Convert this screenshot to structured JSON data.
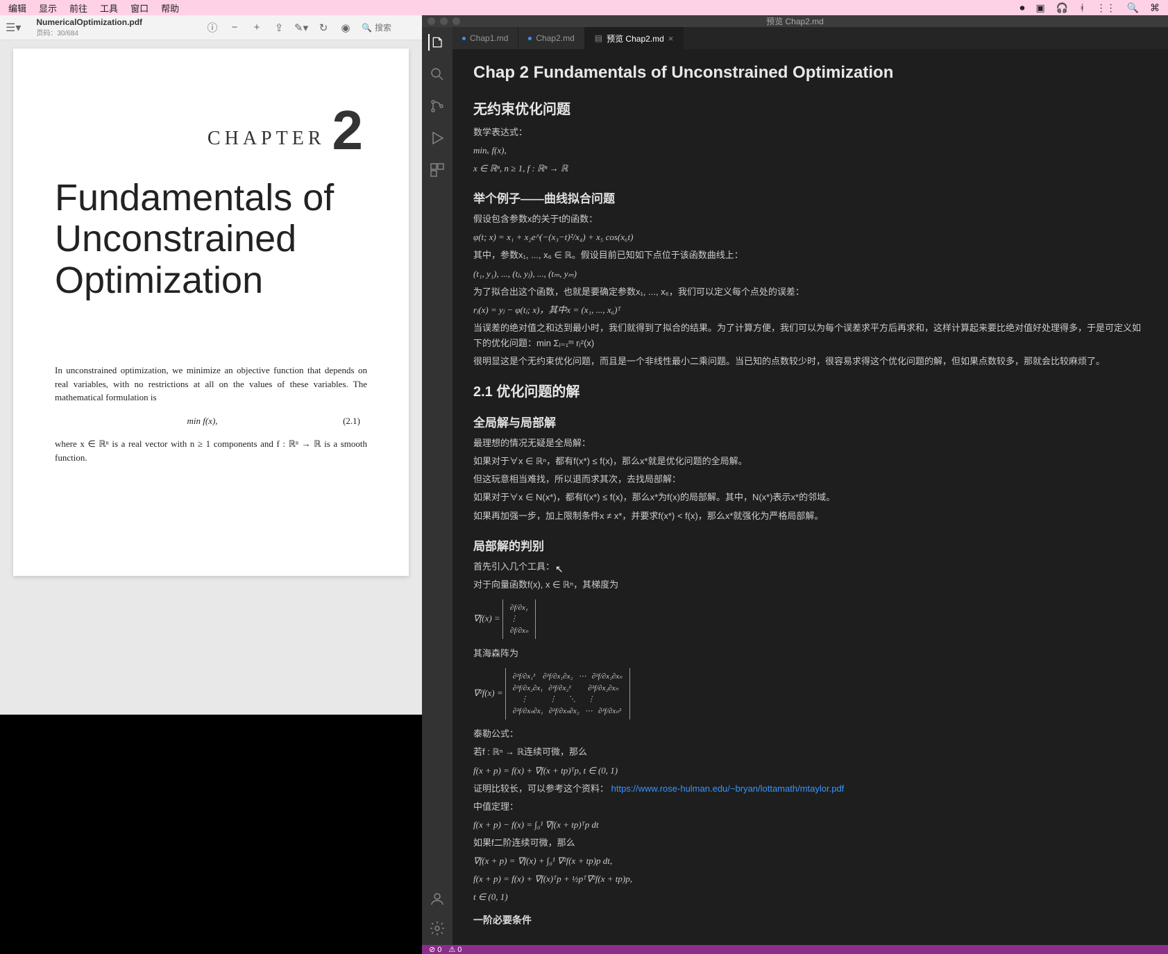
{
  "menubar": {
    "items": [
      "编辑",
      "显示",
      "前往",
      "工具",
      "窗口",
      "帮助"
    ],
    "right_icons": [
      "record",
      "screenshare",
      "headphones",
      "bluetooth",
      "wifi",
      "search",
      "control-center"
    ]
  },
  "pdf": {
    "filename": "NumericalOptimization.pdf",
    "page_info": "页码：30/684",
    "search_placeholder": "搜索",
    "chapter_label": "CHAPTER",
    "chapter_num": "2",
    "chapter_title": "Fundamentals of Unconstrained Optimization",
    "body_para1": "In unconstrained optimization, we minimize an objective function that depends on real variables, with no restrictions at all on the values of these variables. The mathematical formulation is",
    "eq1": "min f(x),",
    "eq1_sub": "x",
    "eq1_label": "(2.1)",
    "body_para2": "where x ∈ ℝⁿ is a real vector with n ≥ 1 components and f : ℝⁿ → ℝ is a smooth function."
  },
  "code": {
    "window_title": "预览 Chap2.md",
    "tabs": [
      {
        "label": "Chap1.md",
        "active": false
      },
      {
        "label": "Chap2.md",
        "active": false
      },
      {
        "label": "预览 Chap2.md",
        "active": true
      }
    ],
    "preview": {
      "h1": "Chap 2 Fundamentals of Unconstrained Optimization",
      "h2_1": "无约束优化问题",
      "p_math_expr": "数学表达式：",
      "math1": "minₓ f(x),",
      "math2": "x ∈ ℝⁿ, n ≥ 1, f : ℝⁿ → ℝ",
      "h3_example": "举个例子——曲线拟合问题",
      "p_ex1": "假设包含参数x的关于t的函数：",
      "math_phi": "φ(t; x) = x₁ + x₂e^(−(x₃−t)²/x₄) + x₅ cos(x₆t)",
      "p_ex2": "其中，参数x₁, ..., x₆ ∈ ℝ。假设目前已知如下点位于该函数曲线上：",
      "math_pts": "(t₁, y₁), ..., (tⱼ, yⱼ), ..., (tₘ, yₘ)",
      "p_fit": "为了拟合出这个函数，也就是要确定参数x₁, ..., x₆，我们可以定义每个点处的误差：",
      "math_rj": "rⱼ(x) = yⱼ − φ(tⱼ; x)，其中x = (x₁, ..., x₆)ᵀ",
      "p_sumsq": "当误差的绝对值之和达到最小时，我们就得到了拟合的结果。为了计算方便，我们可以为每个误差求平方后再求和，这样计算起来要比绝对值好处理得多，于是可定义如下的优化问题：min Σⱼ₌₁ᵐ rⱼ²(x)",
      "p_obvious": "很明显这是个无约束优化问题，而且是一个非线性最小二乘问题。当已知的点数较少时，很容易求得这个优化问题的解，但如果点数较多，那就会比较麻烦了。",
      "h2_2": "2.1 优化问题的解",
      "h3_global": "全局解与局部解",
      "p_ideal": "最理想的情况无疑是全局解：",
      "p_global": "如果对于∀x ∈ ℝⁿ，都有f(x*) ≤ f(x)，那么x*就是优化问题的全局解。",
      "p_but": "但这玩意相当难找，所以退而求其次，去找局部解：",
      "p_local": "如果对于∀x ∈ N(x*)，都有f(x*) ≤ f(x)，那么x*为f(x)的局部解。其中，N(x*)表示x*的邻域。",
      "p_strict": "如果再加强一步，加上限制条件x ≠ x*，并要求f(x*) < f(x)，那么x*就强化为严格局部解。",
      "h3_judge": "局部解的判别",
      "p_tools": "首先引入几个工具：",
      "p_grad": "对于向量函数f(x), x ∈ ℝⁿ，其梯度为",
      "grad_matrix": "∇f(x) = [ ∂f/∂x₁ ; ⋮ ; ∂f/∂xₙ ]",
      "p_hess": "其海森阵为",
      "hess_matrix": "∇²f(x) = [ ∂²f/∂x₁² … ∂²f/∂x₁∂xₙ ; ⋮ ⋱ ⋮ ; ∂²f/∂xₙ∂x₁ … ∂²f/∂xₙ² ]",
      "p_taylor": "泰勒公式：",
      "p_taylor1": "若f : ℝⁿ → ℝ连续可微，那么",
      "math_taylor": "f(x + p) = f(x) + ∇f(x + tp)ᵀp,  t ∈ (0, 1)",
      "p_proof": "证明比较长，可以参考这个资料：",
      "proof_link": "https://www.rose-hulman.edu/~bryan/lottamath/mtaylor.pdf",
      "p_mean": "中值定理：",
      "math_mean": "f(x + p) − f(x) = ∫₀¹ ∇f(x + tp)ᵀp dt",
      "p_taylor2": "如果f二阶连续可微，那么",
      "math_t2a": "∇f(x + p) = ∇f(x) + ∫₀¹ ∇²f(x + tp)p dt,",
      "math_t2b": "f(x + p) = f(x) + ∇f(x)ᵀp + ½pᵀ∇²f(x + tp)p,",
      "math_t2c": "t ∈ (0, 1)",
      "h4_first": "一阶必要条件"
    },
    "status": {
      "errors": "0",
      "warnings": "0"
    }
  }
}
